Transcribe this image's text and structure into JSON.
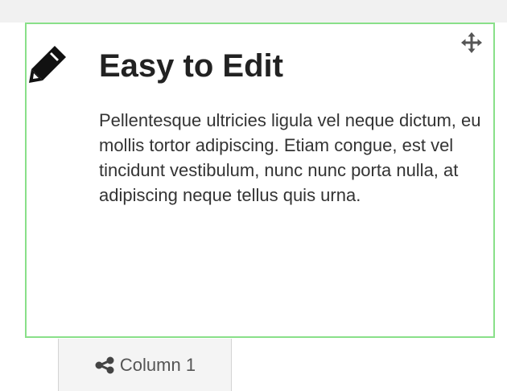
{
  "widget": {
    "title": "Easy to Edit",
    "body": "Pellentesque ultricies ligula vel neque dictum, eu mollis tortor adipiscing. Etiam congue, est vel tincidunt vestibulum, nunc nunc porta nulla, at adipiscing neque tellus quis urna.",
    "icon": "pencil-icon"
  },
  "controls": {
    "move_icon": "move-icon"
  },
  "column_tab": {
    "label": "Column 1",
    "icon": "share-icon"
  },
  "colors": {
    "selection_border": "#89e089",
    "title_text": "#222222",
    "body_text": "#333333",
    "tab_background": "#f4f4f4"
  }
}
